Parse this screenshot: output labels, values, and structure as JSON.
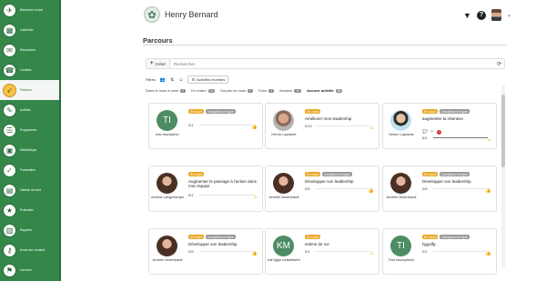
{
  "sidebar": {
    "items": [
      {
        "label": "Bienvenue à bord",
        "icon": "rocket-icon",
        "glyph": "✈"
      },
      {
        "label": "Calendrier",
        "icon": "calendar-icon",
        "glyph": "▦"
      },
      {
        "label": "Discussions",
        "icon": "chat-icon",
        "glyph": "✉"
      },
      {
        "label": "Contacts",
        "icon": "contacts-icon",
        "glyph": "☎"
      },
      {
        "label": "Parcours",
        "icon": "route-icon",
        "glyph": "➶",
        "active": true
      },
      {
        "label": "Activités",
        "icon": "activities-icon",
        "glyph": "✎"
      },
      {
        "label": "Programmes",
        "icon": "programs-icon",
        "glyph": "☰"
      },
      {
        "label": "Médiathèque",
        "icon": "library-icon",
        "glyph": "▣"
      },
      {
        "label": "Formulaires",
        "icon": "forms-icon",
        "glyph": "✓"
      },
      {
        "label": "Tableau de bord",
        "icon": "dashboard-icon",
        "glyph": "▤"
      },
      {
        "label": "Évaluation",
        "icon": "evaluation-icon",
        "glyph": "★"
      },
      {
        "label": "Rapports",
        "icon": "reports-icon",
        "glyph": "▥"
      },
      {
        "label": "Accès aux contacts",
        "icon": "access-icon",
        "glyph": "⚷"
      },
      {
        "label": "Licences",
        "icon": "licence-icon",
        "glyph": "⚑"
      }
    ]
  },
  "header": {
    "user_name": "Henry Bernard",
    "logo_icon": "brain-logo-icon",
    "filter_icon": "filter-icon",
    "help_icon": "help-icon"
  },
  "page": {
    "title": "Parcours",
    "create_label": "Créer",
    "search_placeholder": "Rechercher",
    "filters_label": "Filtres",
    "recent_label": "Activités récentes"
  },
  "status_filters": [
    {
      "label": "Dans le mois à venir",
      "count": "0",
      "active": false
    },
    {
      "label": "En retard",
      "count": "23",
      "active": false
    },
    {
      "label": "Depuis un mois",
      "count": "0",
      "active": false
    },
    {
      "label": "Futur",
      "count": "0",
      "active": false
    },
    {
      "label": "Anciens",
      "count": "24",
      "active": false
    },
    {
      "label": "Aucune activité",
      "count": "23",
      "active": true
    }
  ],
  "cards": [
    {
      "name": "test inscription",
      "initials": "TI",
      "avatar": "initials",
      "status": "En cours",
      "type": "Inscription en ligne",
      "course": "",
      "progress": "0/1",
      "ratio": 0,
      "indicator": "thumb",
      "extras": false
    },
    {
      "name": "Henry Laplante",
      "initials": "",
      "avatar": "bald",
      "status": "En cours",
      "type": "",
      "course": "Améliorer mon leadership",
      "progress": "0/10",
      "ratio": 0,
      "indicator": "warning",
      "extras": false
    },
    {
      "name": "Simon Laplante",
      "initials": "",
      "avatar": "blue",
      "status": "En cours",
      "type": "Inscription en ligne",
      "course": "augmenter la rétention",
      "progress": "5/1",
      "ratio": 1,
      "indicator": "warning",
      "extras": true
    },
    {
      "name": "Anicka Langchamps",
      "initials": "",
      "avatar": "photo",
      "status": "En cours",
      "type": "",
      "course": "Augmenter le passage à l'action dans mon équipe",
      "progress": "0/1",
      "ratio": 0,
      "indicator": "warning",
      "extras": false
    },
    {
      "name": "Andrée Arseneault",
      "initials": "",
      "avatar": "photo",
      "status": "En cours",
      "type": "Inscription en ligne",
      "course": "Développer son leadership",
      "progress": "0/5",
      "ratio": 0,
      "indicator": "thumb",
      "extras": false
    },
    {
      "name": "Andrée Arseneault",
      "initials": "",
      "avatar": "photo",
      "status": "En cours",
      "type": "Inscription en ligne",
      "course": "Développer son leadership",
      "progress": "0/5",
      "ratio": 0,
      "indicator": "thumb",
      "extras": false
    },
    {
      "name": "Andrée Arseneault",
      "initials": "",
      "avatar": "photo",
      "status": "En cours",
      "type": "Inscription en ligne",
      "course": "Développer son leadership",
      "progress": "0/5",
      "ratio": 0,
      "indicator": "thumb",
      "extras": false
    },
    {
      "name": "kdf lglgn mdsbfdsfm",
      "initials": "KM",
      "avatar": "initials",
      "status": "En cours",
      "type": "",
      "course": "estime de soi",
      "progress": "0/1",
      "ratio": 0,
      "indicator": "warning",
      "extras": false
    },
    {
      "name": "Test inscription2",
      "initials": "TI",
      "avatar": "initials",
      "status": "En cours",
      "type": "Inscription en ligne",
      "course": "hjgydfg",
      "progress": "0/1",
      "ratio": 0,
      "indicator": "thumb",
      "extras": false
    }
  ]
}
